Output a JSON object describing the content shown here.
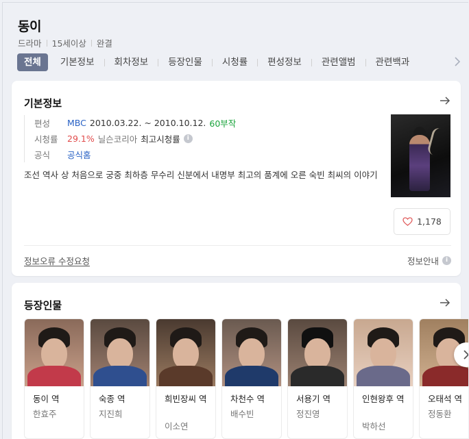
{
  "header": {
    "title": "동이",
    "meta": [
      "드라마",
      "15세이상",
      "완결"
    ]
  },
  "tabs": [
    "전체",
    "기본정보",
    "회차정보",
    "등장인물",
    "시청률",
    "편성정보",
    "관련앨범",
    "관련백과"
  ],
  "basic_info": {
    "section_title": "기본정보",
    "broadcast": {
      "key": "편성",
      "channel": "MBC",
      "period": "2010.03.22. ~ 2010.10.12.",
      "episodes": "60부작"
    },
    "rating": {
      "key": "시청률",
      "value": "29.1%",
      "source": "닐슨코리아",
      "label": "최고시청률"
    },
    "official": {
      "key": "공식",
      "link": "공식홈"
    },
    "description": "조선 역사 상 처음으로 궁중 최하층 무수리 신분에서 내명부 최고의 품계에 오른 숙빈 최씨의 이야기",
    "like_count": "1,178",
    "report_link": "정보오류 수정요청",
    "info_guide": "정보안내"
  },
  "cast": {
    "section_title": "등장인물",
    "members": [
      {
        "role": "동이 역",
        "actor": "한효주"
      },
      {
        "role": "숙종 역",
        "actor": "지진희"
      },
      {
        "role": "희빈장씨 역",
        "actor": "이소연"
      },
      {
        "role": "차천수 역",
        "actor": "배수빈"
      },
      {
        "role": "서용기 역",
        "actor": "정진영"
      },
      {
        "role": "인현왕후 역",
        "actor": "박하선"
      },
      {
        "role": "오태석 역",
        "actor": "정동환"
      }
    ]
  },
  "colors": {
    "active_tab": "#6a7591",
    "link": "#2861c4",
    "episodes": "#19a33b",
    "rating": "#e14b4b"
  }
}
